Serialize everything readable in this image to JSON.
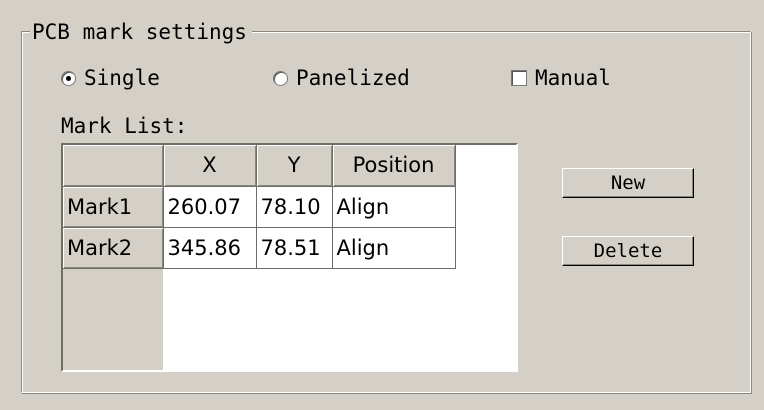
{
  "group": {
    "title": "PCB mark settings"
  },
  "options": {
    "single": {
      "label": "Single",
      "selected": true
    },
    "panelized": {
      "label": "Panelized",
      "selected": false
    },
    "manual": {
      "label": "Manual",
      "checked": false
    }
  },
  "mark_list": {
    "label": "Mark List:",
    "columns": [
      "",
      "X",
      "Y",
      "Position"
    ],
    "rows": [
      {
        "name": "Mark1",
        "x": "260.07",
        "y": "78.10",
        "position": "Align"
      },
      {
        "name": "Mark2",
        "x": "345.86",
        "y": "78.51",
        "position": "Align"
      }
    ]
  },
  "buttons": {
    "new_label": "New",
    "delete_label": "Delete"
  }
}
